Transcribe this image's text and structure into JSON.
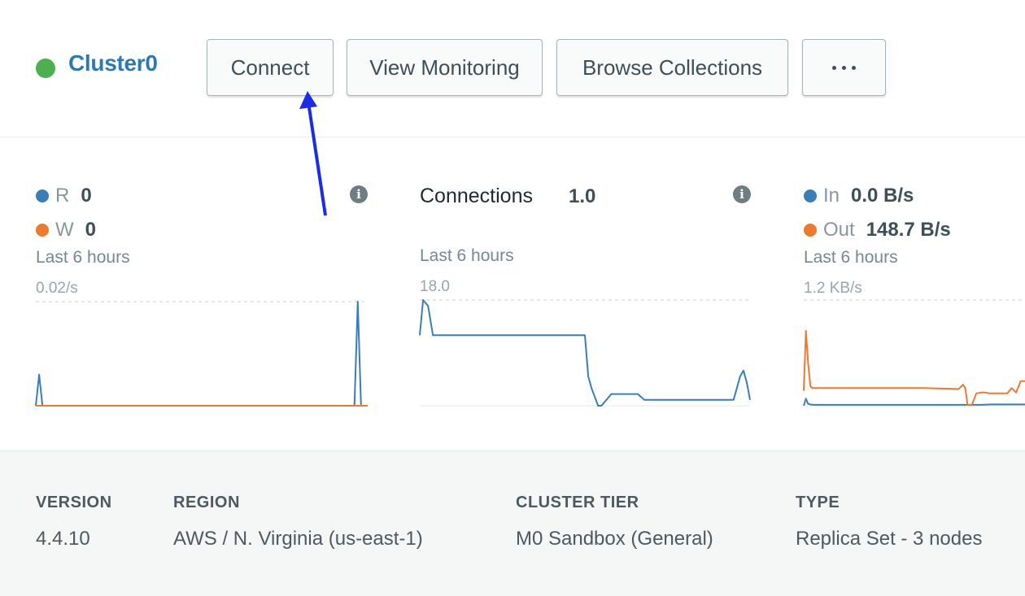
{
  "cluster": {
    "name": "Cluster0",
    "status_color": "#4caf50"
  },
  "buttons": {
    "connect": "Connect",
    "view_monitoring": "View Monitoring",
    "browse_collections": "Browse Collections",
    "more_icon": "more-horizontal-icon"
  },
  "colors": {
    "series_blue": "#3b7db4",
    "series_orange": "#ec7a31",
    "link": "#2e7ab0",
    "annotation_arrow": "#1a2ce8"
  },
  "metrics": {
    "ops": {
      "r_label": "R",
      "r_value": "0",
      "w_label": "W",
      "w_value": "0",
      "period": "Last 6 hours",
      "max_label": "0.02/s"
    },
    "connections": {
      "title": "Connections",
      "value": "1.0",
      "period": "Last 6 hours",
      "max_label": "18.0"
    },
    "network": {
      "in_label": "In",
      "in_value": "0.0 B/s",
      "out_label": "Out",
      "out_value": "148.7 B/s",
      "period": "Last 6 hours",
      "max_label": "1.2 KB/s"
    }
  },
  "chart_data": [
    {
      "type": "line",
      "ylabel": "",
      "xlabel": "",
      "ylim": [
        0,
        0.02
      ],
      "series": [
        {
          "name": "R",
          "color": "#3b7db4",
          "x": [
            0,
            1,
            2,
            3,
            58,
            96,
            97,
            98,
            99,
            100
          ],
          "values": [
            0,
            0.006,
            0,
            0,
            0,
            0,
            0.02,
            0,
            0,
            0
          ]
        },
        {
          "name": "W",
          "color": "#ec7a31",
          "x": [
            0,
            100
          ],
          "values": [
            0,
            0
          ]
        }
      ]
    },
    {
      "type": "line",
      "ylabel": "",
      "xlabel": "",
      "ylim": [
        0,
        18
      ],
      "series": [
        {
          "name": "Connections",
          "color": "#3b7db4",
          "x": [
            0,
            1,
            2.5,
            4,
            20,
            40,
            43,
            45,
            48,
            50,
            51,
            52,
            53,
            54,
            55,
            58,
            60,
            62,
            64,
            66,
            68,
            80,
            90,
            95,
            96,
            97,
            98,
            99,
            100
          ],
          "values": [
            12,
            18,
            17,
            12,
            12,
            12,
            12,
            12,
            12,
            12,
            5,
            3,
            1.5,
            0,
            0,
            2,
            2,
            2,
            2,
            2,
            1,
            1,
            1,
            1,
            3,
            5,
            6,
            4,
            1
          ]
        }
      ]
    },
    {
      "type": "line",
      "ylabel": "",
      "xlabel": "",
      "ylim": [
        0,
        1200
      ],
      "series": [
        {
          "name": "In",
          "color": "#3b7db4",
          "x": [
            0,
            1,
            2,
            4,
            30,
            60,
            75,
            80,
            85,
            90,
            100
          ],
          "values": [
            0,
            80,
            20,
            10,
            10,
            10,
            10,
            10,
            15,
            15,
            15
          ]
        },
        {
          "name": "Out",
          "color": "#ec7a31",
          "x": [
            0,
            1,
            2,
            3,
            4,
            5,
            25,
            55,
            70,
            72,
            73,
            74,
            75,
            76,
            78,
            80,
            82,
            84,
            86,
            88,
            90,
            92,
            94,
            96,
            98,
            100
          ],
          "values": [
            170,
            850,
            480,
            220,
            200,
            200,
            200,
            200,
            190,
            240,
            200,
            10,
            10,
            10,
            140,
            150,
            150,
            140,
            140,
            140,
            140,
            140,
            200,
            150,
            280,
            280
          ]
        }
      ]
    }
  ]
}
